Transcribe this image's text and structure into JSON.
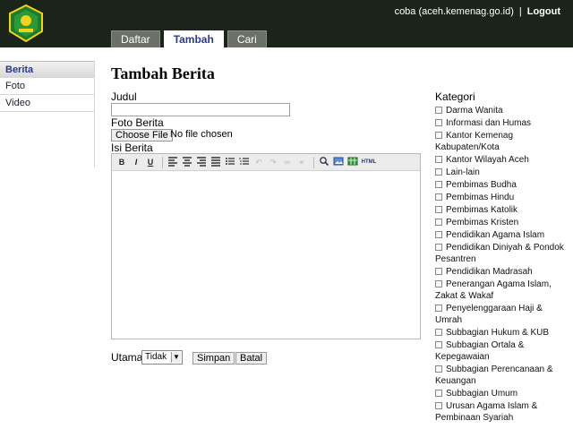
{
  "header": {
    "user": "coba (aceh.kemenag.go.id)",
    "separator": "|",
    "logout": "Logout"
  },
  "tabs": [
    {
      "label": "Daftar"
    },
    {
      "label": "Tambah"
    },
    {
      "label": "Cari"
    }
  ],
  "sidebar": {
    "items": [
      {
        "label": "Berita"
      },
      {
        "label": "Foto"
      },
      {
        "label": "Video"
      }
    ]
  },
  "form": {
    "title": "Tambah Berita",
    "judul_label": "Judul",
    "judul_value": "",
    "foto_label": "Foto Berita",
    "file_button": "Choose File",
    "file_status": "No file chosen",
    "isi_label": "Isi Berita",
    "toolbar": [
      "B",
      "I",
      "U",
      "align-left-icon",
      "align-center-icon",
      "align-right-icon",
      "align-justify-icon",
      "bullet-list-icon",
      "numbered-list-icon",
      "undo-icon",
      "redo-icon",
      "link-icon",
      "unlink-icon",
      "search-icon",
      "image-icon",
      "table-icon",
      "HTML"
    ],
    "utama_label": "Utama",
    "utama_value": "Tidak",
    "simpan": "Simpan",
    "batal": "Batal"
  },
  "kategori": {
    "title": "Kategori",
    "items": [
      "Darma Wanita",
      "Informasi dan Humas",
      "Kantor Kemenag Kabupaten/Kota",
      "Kantor Wilayah Aceh",
      "Lain-lain",
      "Pembimas Budha",
      "Pembimas Hindu",
      "Pembimas Katolik",
      "Pembimas Kristen",
      "Pendidikan Agama Islam",
      "Pendidikan Diniyah & Pondok Pesantren",
      "Pendidikan Madrasah",
      "Penerangan Agama Islam, Zakat & Wakaf",
      "Penyelenggaraan Haji & Umrah",
      "Subbagian Hukum & KUB",
      "Subbagian Ortala & Kepegawaian",
      "Subbagian Perencanaan & Keuangan",
      "Subbagian Umum",
      "Urusan Agama Islam & Pembinaan Syariah"
    ]
  },
  "colors": {
    "header_bg": "#1a2418",
    "tab_active_text": "#2a3a8a"
  }
}
